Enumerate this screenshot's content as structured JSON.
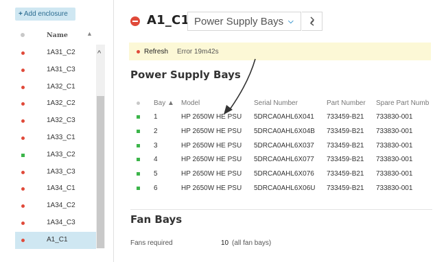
{
  "sidebar": {
    "add_button": "Add enclosure",
    "column_name": "Name",
    "sort_indicator": "▲",
    "items": [
      {
        "name": "1A31_C2",
        "status": "red"
      },
      {
        "name": "1A31_C3",
        "status": "red"
      },
      {
        "name": "1A32_C1",
        "status": "red"
      },
      {
        "name": "1A32_C2",
        "status": "red"
      },
      {
        "name": "1A32_C3",
        "status": "red"
      },
      {
        "name": "1A33_C1",
        "status": "red"
      },
      {
        "name": "1A33_C2",
        "status": "green"
      },
      {
        "name": "1A33_C3",
        "status": "red"
      },
      {
        "name": "1A34_C1",
        "status": "red"
      },
      {
        "name": "1A34_C2",
        "status": "red"
      },
      {
        "name": "1A34_C3",
        "status": "red"
      },
      {
        "name": "A1_C1",
        "status": "red",
        "selected": true
      }
    ]
  },
  "header": {
    "title": "A1_C1",
    "view_selector": "Power Supply Bays"
  },
  "status_bar": {
    "refresh": "Refresh",
    "error": "Error  19m42s"
  },
  "power_supply": {
    "heading": "Power Supply Bays",
    "columns": {
      "bay": "Bay ▲",
      "model": "Model",
      "serial": "Serial Number",
      "part": "Part Number",
      "spare": "Spare Part Numb"
    },
    "rows": [
      {
        "bay": "1",
        "model": "HP 2650W HE PSU",
        "serial": "5DRCA0AHL6X041",
        "part": "733459-B21",
        "spare": "733830-001"
      },
      {
        "bay": "2",
        "model": "HP 2650W HE PSU",
        "serial": "5DRCA0AHL6X04B",
        "part": "733459-B21",
        "spare": "733830-001"
      },
      {
        "bay": "3",
        "model": "HP 2650W HE PSU",
        "serial": "5DRCA0AHL6X037",
        "part": "733459-B21",
        "spare": "733830-001"
      },
      {
        "bay": "4",
        "model": "HP 2650W HE PSU",
        "serial": "5DRCA0AHL6X077",
        "part": "733459-B21",
        "spare": "733830-001"
      },
      {
        "bay": "5",
        "model": "HP 2650W HE PSU",
        "serial": "5DRCA0AHL6X076",
        "part": "733459-B21",
        "spare": "733830-001"
      },
      {
        "bay": "6",
        "model": "HP 2650W HE PSU",
        "serial": "5DRCA0AHL6X06U",
        "part": "733459-B21",
        "spare": "733830-001"
      }
    ]
  },
  "fan_bays": {
    "heading": "Fan Bays",
    "required_label": "Fans required",
    "required_value": "10",
    "required_note": "(all fan bays)"
  },
  "colors": {
    "critical": "#e04a3a",
    "ok": "#3cb54a",
    "accent": "#1e88c8",
    "selected_bg": "#cfe7f2",
    "status_bg": "#fcf8d6"
  }
}
